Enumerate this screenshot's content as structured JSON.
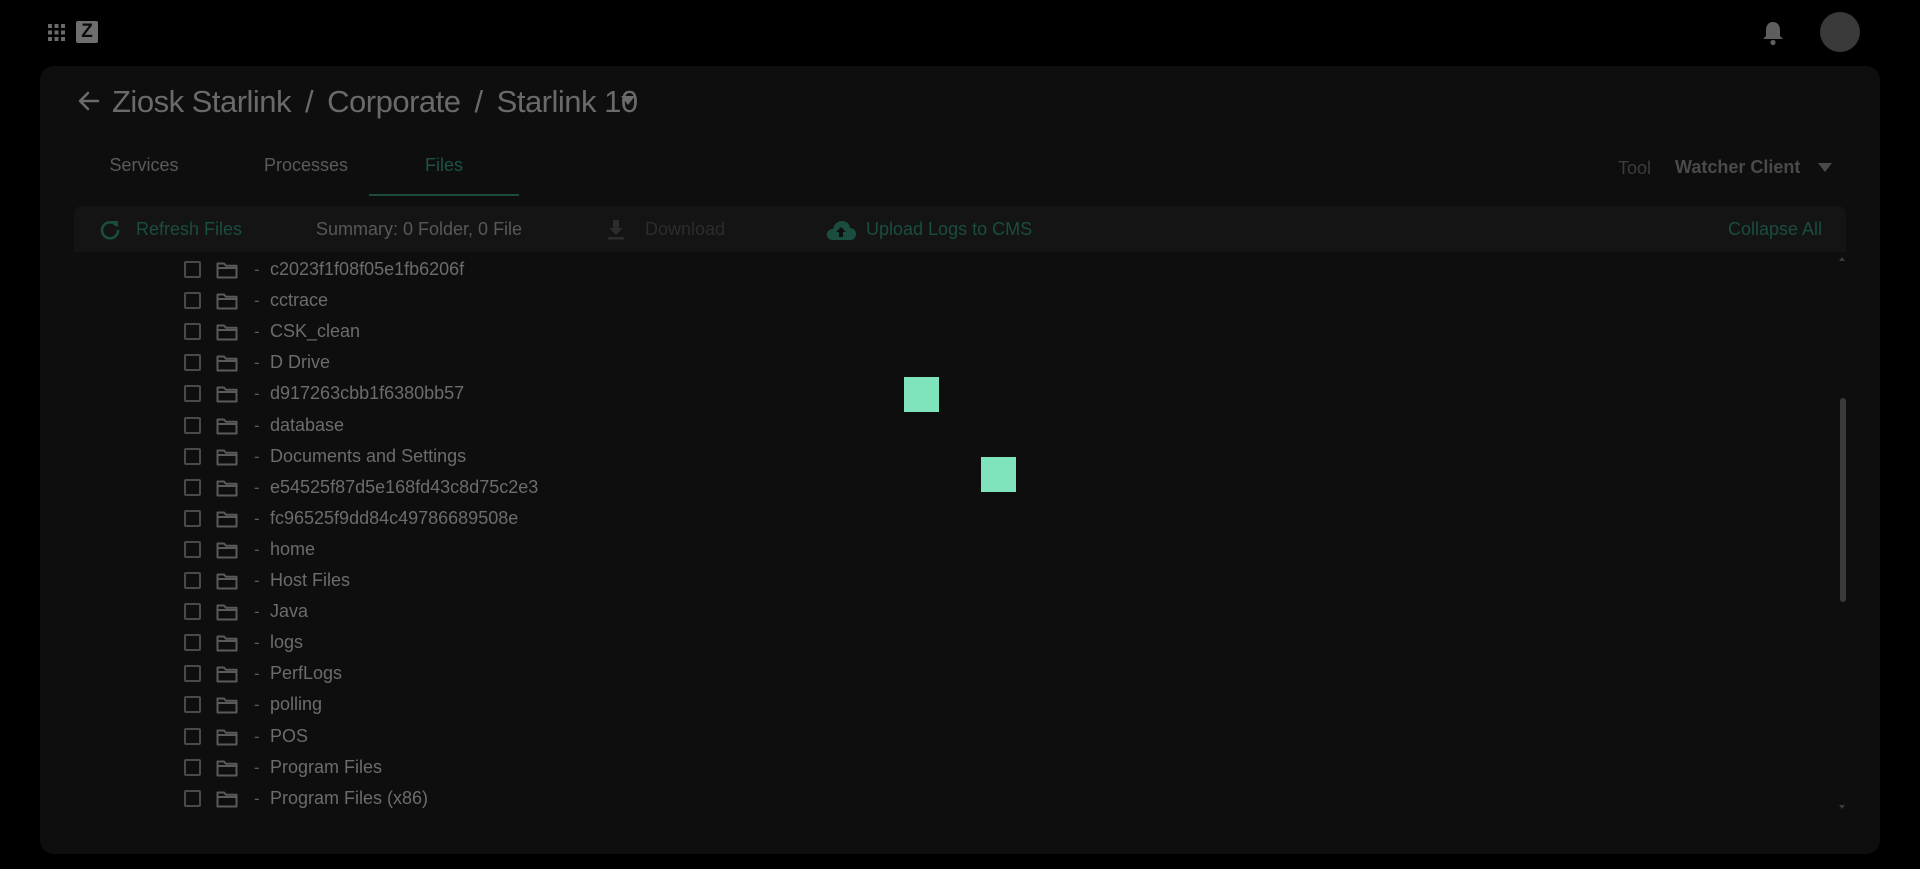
{
  "header": {
    "apps_icon": "grid-apps-icon",
    "logo_letter": "Z",
    "bell_icon": "bell-icon",
    "avatar_icon": "avatar"
  },
  "breadcrumb": {
    "parts": [
      "Ziosk Starlink",
      "Corporate",
      "Starlink 10"
    ],
    "separator": "/"
  },
  "tabs": [
    {
      "label": "Services",
      "active": false
    },
    {
      "label": "Processes",
      "active": false
    },
    {
      "label": "Files",
      "active": true
    }
  ],
  "tool": {
    "label": "Tool",
    "value": "Watcher Client"
  },
  "toolbar": {
    "refresh_label": "Refresh Files",
    "summary": "Summary: 0 Folder, 0 File",
    "download_label": "Download",
    "upload_label": "Upload Logs to CMS",
    "collapse_label": "Collapse All"
  },
  "files": [
    {
      "dash": "-",
      "name": "c2023f1f08f05e1fb6206f"
    },
    {
      "dash": "-",
      "name": "cctrace"
    },
    {
      "dash": "-",
      "name": "CSK_clean"
    },
    {
      "dash": "-",
      "name": "D Drive"
    },
    {
      "dash": "-",
      "name": "d917263cbb1f6380bb57"
    },
    {
      "dash": "-",
      "name": "database"
    },
    {
      "dash": "-",
      "name": "Documents and Settings"
    },
    {
      "dash": "-",
      "name": "e54525f87d5e168fd43c8d75c2e3"
    },
    {
      "dash": "-",
      "name": "fc96525f9dd84c49786689508e"
    },
    {
      "dash": "-",
      "name": "home"
    },
    {
      "dash": "-",
      "name": "Host Files"
    },
    {
      "dash": "-",
      "name": "Java"
    },
    {
      "dash": "-",
      "name": "logs"
    },
    {
      "dash": "-",
      "name": "PerfLogs"
    },
    {
      "dash": "-",
      "name": "polling"
    },
    {
      "dash": "-",
      "name": "POS"
    },
    {
      "dash": "-",
      "name": "Program Files"
    },
    {
      "dash": "-",
      "name": "Program Files (x86)"
    }
  ],
  "colors": {
    "background": "#000000",
    "card": "#0e0e0e",
    "accent_dim": "#1a4d40",
    "loader_square": "#7fe3bb"
  }
}
